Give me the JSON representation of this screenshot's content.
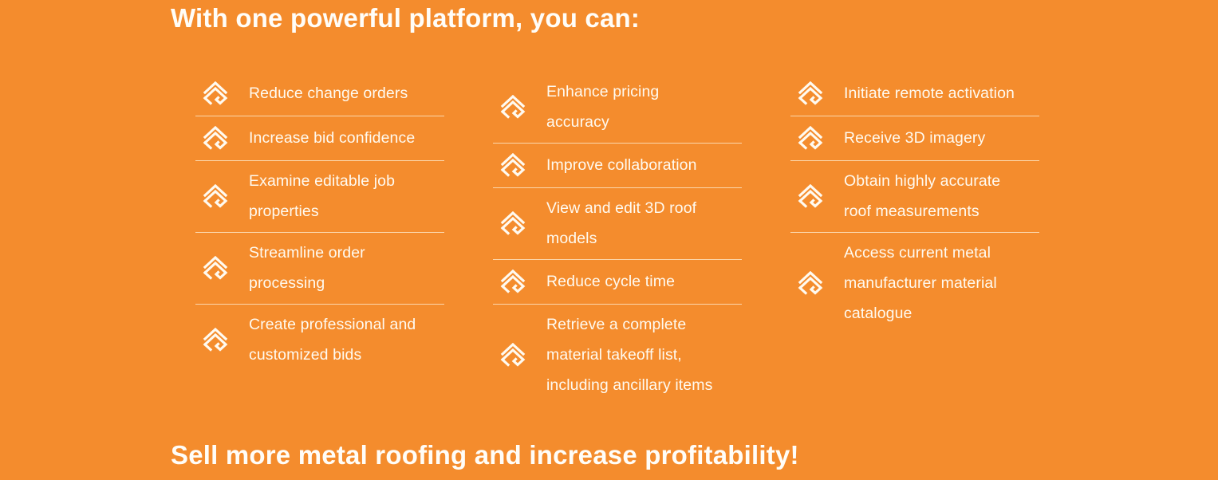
{
  "colors": {
    "background": "#f48c2d",
    "text": "#ffffff",
    "divider": "#ffe9cc"
  },
  "headings": {
    "top": "With one powerful platform, you can:",
    "bottom": "Sell more metal roofing and increase profitability!"
  },
  "item_icon": "roof-chevron-icon",
  "columns": [
    {
      "items": [
        {
          "label": "Reduce change orders"
        },
        {
          "label": "Increase bid confidence"
        },
        {
          "label": "Examine editable job properties"
        },
        {
          "label": "Streamline order processing"
        },
        {
          "label": "Create professional and customized bids"
        }
      ]
    },
    {
      "items": [
        {
          "label": "Enhance pricing accuracy"
        },
        {
          "label": "Improve collaboration"
        },
        {
          "label": "View and edit 3D roof models"
        },
        {
          "label": "Reduce cycle time"
        },
        {
          "label": "Retrieve a complete material takeoff list, including ancillary items"
        }
      ]
    },
    {
      "items": [
        {
          "label": "Initiate remote activation"
        },
        {
          "label": "Receive 3D imagery"
        },
        {
          "label": "Obtain highly accurate roof measurements"
        },
        {
          "label": "Access current metal manufacturer material catalogue"
        }
      ]
    }
  ]
}
